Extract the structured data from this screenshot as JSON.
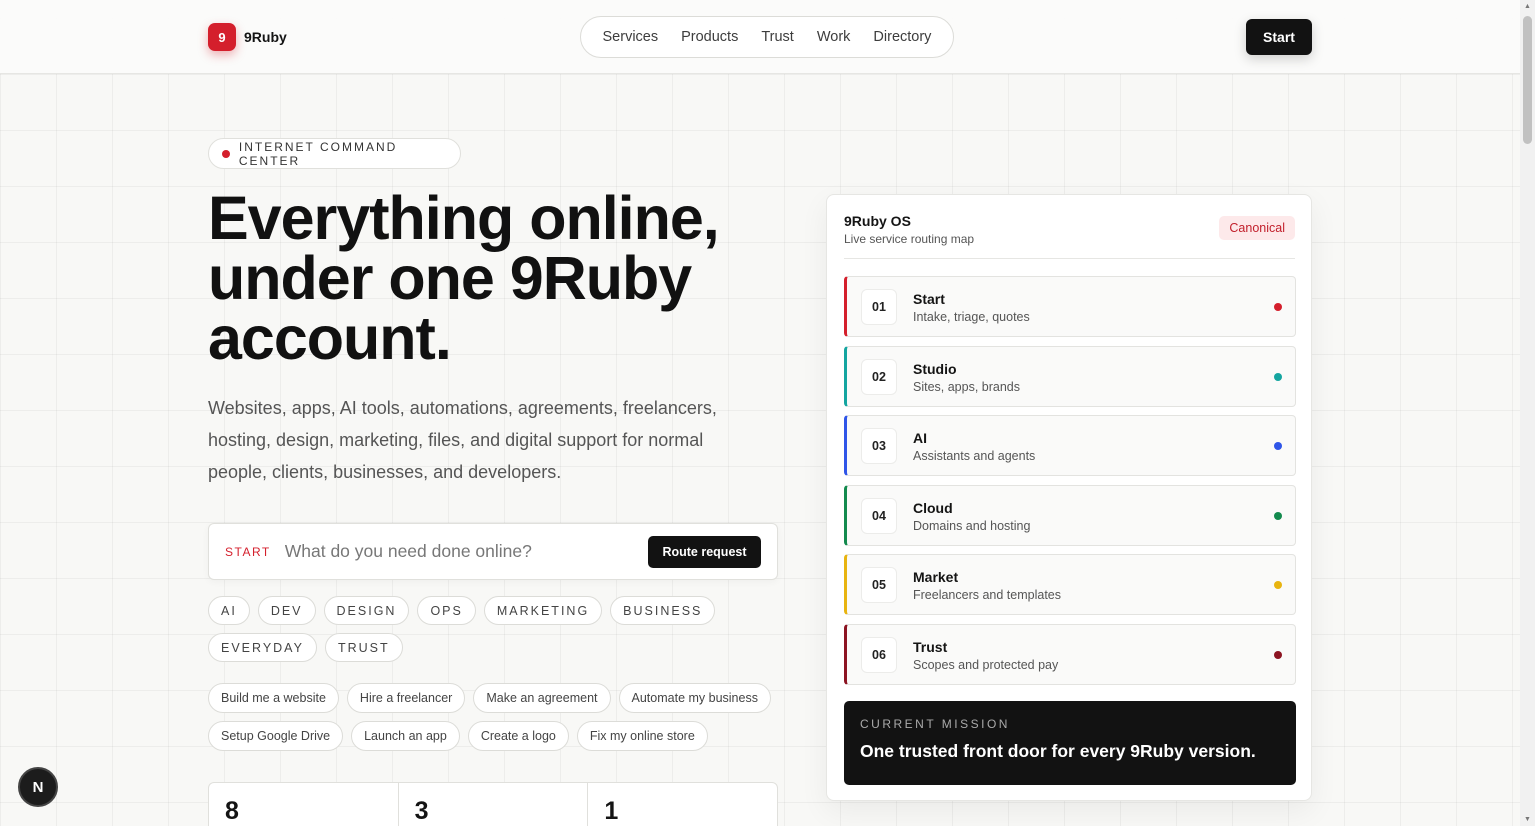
{
  "header": {
    "logo_mark": "9",
    "logo_text": "9Ruby",
    "nav": [
      "Services",
      "Products",
      "Trust",
      "Work",
      "Directory"
    ],
    "start_label": "Start"
  },
  "hero": {
    "eyebrow": "INTERNET COMMAND CENTER",
    "title": "Everything online, under one 9Ruby account.",
    "description": "Websites, apps, AI tools, automations, agreements, freelancers, hosting, design, marketing, files, and digital support for normal people, clients, businesses, and developers."
  },
  "search": {
    "label": "START",
    "placeholder": "What do you need done online?",
    "button": "Route request"
  },
  "categories": [
    "AI",
    "DEV",
    "DESIGN",
    "OPS",
    "MARKETING",
    "BUSINESS",
    "EVERYDAY",
    "TRUST"
  ],
  "suggestions": [
    "Build me a website",
    "Hire a freelancer",
    "Make an agreement",
    "Automate my business",
    "Setup Google Drive",
    "Launch an app",
    "Create a logo",
    "Fix my online store"
  ],
  "stats": [
    "8",
    "3",
    "1"
  ],
  "os_card": {
    "title": "9Ruby OS",
    "subtitle": "Live service routing map",
    "badge": "Canonical",
    "routes": [
      {
        "num": "01",
        "name": "Start",
        "desc": "Intake, triage, quotes",
        "color": "#d41f2c"
      },
      {
        "num": "02",
        "name": "Studio",
        "desc": "Sites, apps, brands",
        "color": "#14a5a0"
      },
      {
        "num": "03",
        "name": "AI",
        "desc": "Assistants and agents",
        "color": "#2f55e8"
      },
      {
        "num": "04",
        "name": "Cloud",
        "desc": "Domains and hosting",
        "color": "#138a4e"
      },
      {
        "num": "05",
        "name": "Market",
        "desc": "Freelancers and templates",
        "color": "#e8b410"
      },
      {
        "num": "06",
        "name": "Trust",
        "desc": "Scopes and protected pay",
        "color": "#8c1422"
      }
    ],
    "mission_label": "CURRENT MISSION",
    "mission_text": "One trusted front door for every 9Ruby version."
  },
  "floating_badge": "N"
}
